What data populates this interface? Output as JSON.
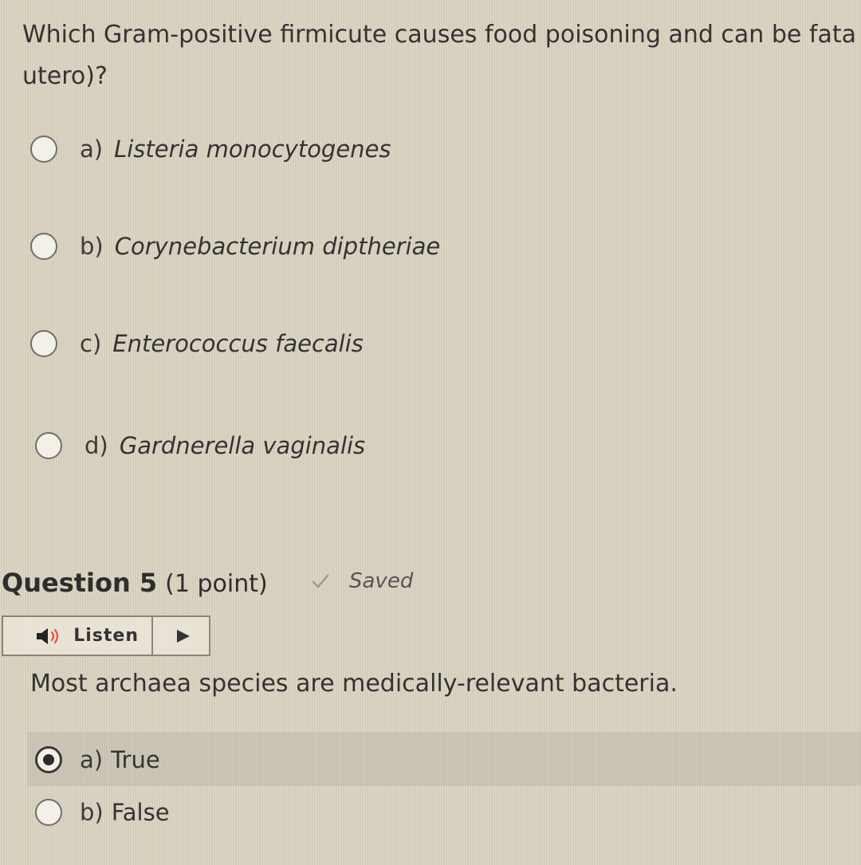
{
  "question4": {
    "text": "Which Gram-positive firmicute causes food poisoning and can be fata\nutero)?",
    "options": [
      {
        "letter": "a)",
        "label": "Listeria monocytogenes",
        "selected": false
      },
      {
        "letter": "b)",
        "label": "Corynebacterium diptheriae",
        "selected": false
      },
      {
        "letter": "c)",
        "label": "Enterococcus faecalis",
        "selected": false
      },
      {
        "letter": "d)",
        "label": "Gardnerella vaginalis",
        "selected": false
      }
    ]
  },
  "question5": {
    "title": "Question 5",
    "points": "(1 point)",
    "status": "Saved",
    "listen_label": "Listen",
    "text": "Most archaea species are medically-relevant bacteria.",
    "options": [
      {
        "letter": "a)",
        "label": "True",
        "selected": true
      },
      {
        "letter": "b)",
        "label": "False",
        "selected": false
      }
    ]
  },
  "icons": {
    "check": "check-icon",
    "speaker": "speaker-icon",
    "play": "play-icon"
  },
  "colors": {
    "background": "#dcd4c2",
    "speaker_wave": "#e0533a",
    "check": "#9a9a9a"
  }
}
